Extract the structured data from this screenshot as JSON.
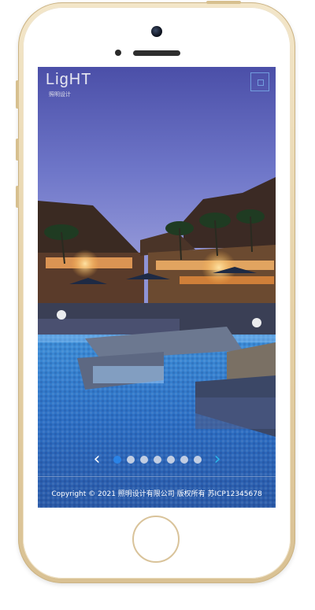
{
  "device": {
    "frame_color": "#e6d2a8"
  },
  "header": {
    "logo_text": "LigHT",
    "logo_subtitle": "照明设计",
    "menu_icon": "menu-icon"
  },
  "hero": {
    "description_icon": "resort-pool-photo"
  },
  "slider": {
    "prev_label": "‹",
    "next_label": "›",
    "dot_count": 7,
    "active_index": 0,
    "accent_color": "#2a83e6",
    "next_color": "#29b6e8"
  },
  "footer": {
    "copyright": "Copyright © 2021 照明设计有限公司 版权所有 苏ICP12345678"
  }
}
